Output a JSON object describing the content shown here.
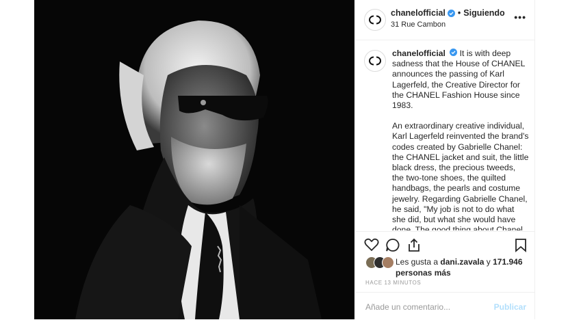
{
  "post": {
    "username": "chanelofficial",
    "separator": "•",
    "follow_status": "Siguiendo",
    "location": "31 Rue Cambon",
    "more_label": "•••",
    "photo_alt": "Karl Lagerfeld"
  },
  "caption": {
    "username": "chanelofficial",
    "paragraph1": "It is with deep sadness that the House of CHANEL announces the passing of Karl Lagerfeld, the Creative Director for the CHANEL Fashion House since 1983.",
    "paragraph2": "An extraordinary creative individual, Karl Lagerfeld reinvented the brand's codes created by Gabrielle Chanel: the CHANEL jacket and suit, the little black dress, the precious tweeds, the two-tone shoes, the quilted handbags, the pearls and costume jewelry. Regarding Gabrielle Chanel, he said, \"My job is not to do what she did, but what she would have done. The good thing about Chanel is it is an idea you can adapt to many things.\" A prolific creative mind with endless"
  },
  "actions": {
    "like": "heart-icon",
    "comment": "comment-icon",
    "share": "share-icon",
    "save": "bookmark-icon"
  },
  "likes": {
    "prefix": "Les gusta a",
    "user": "dani.zavala",
    "connector": "y",
    "count": "171.946 personas más"
  },
  "timestamp": "HACE 13 MINUTOS",
  "comment_box": {
    "placeholder": "Añade un comentario...",
    "publish_label": "Publicar"
  },
  "colors": {
    "verified": "#3897f0",
    "publish_disabled": "#b2dffc",
    "border": "#efefef"
  }
}
